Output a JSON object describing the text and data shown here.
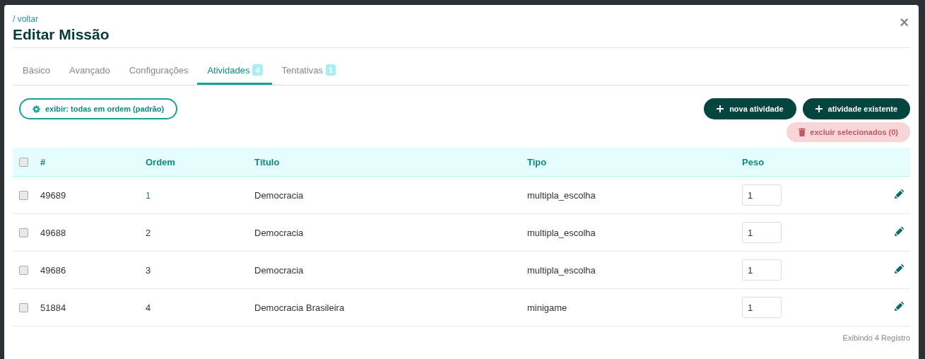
{
  "modal": {
    "back_link": "/ voltar",
    "title": "Editar Missão",
    "close": "×"
  },
  "tabs": [
    {
      "label": "Básico",
      "selected": false
    },
    {
      "label": "Avançado",
      "selected": false
    },
    {
      "label": "Configurações",
      "selected": false
    },
    {
      "label": "Atividades",
      "badge": "4",
      "selected": true
    },
    {
      "label": "Tentativas",
      "badge": "1",
      "selected": false
    }
  ],
  "toolbar": {
    "filter_button": "exibir: todas em ordem (padrão)",
    "new_button": "nova atividade",
    "existing_button": "atividade existente",
    "delete_button": {
      "label": "excluir selecionados (0)",
      "disabled": true
    }
  },
  "table": {
    "select_all_checked": false,
    "columns": [
      "#",
      "Ordem",
      "Título",
      "Tipo",
      "Peso"
    ],
    "rows": [
      {
        "checked": false,
        "id": "49689",
        "order": "1",
        "order_link": true,
        "title": "Democracia",
        "type": "multipla_escolha",
        "weight": "1"
      },
      {
        "checked": false,
        "id": "49688",
        "order": "2",
        "order_link": false,
        "title": "Democracia",
        "type": "multipla_escolha",
        "weight": "1"
      },
      {
        "checked": false,
        "id": "49686",
        "order": "3",
        "order_link": false,
        "title": "Democracia",
        "type": "multipla_escolha",
        "weight": "1"
      },
      {
        "checked": false,
        "id": "51884",
        "order": "4",
        "order_link": false,
        "title": "Democracia Brasileira",
        "type": "minigame",
        "weight": "1"
      }
    ]
  },
  "footer": "Exibindo 4 Registro"
}
